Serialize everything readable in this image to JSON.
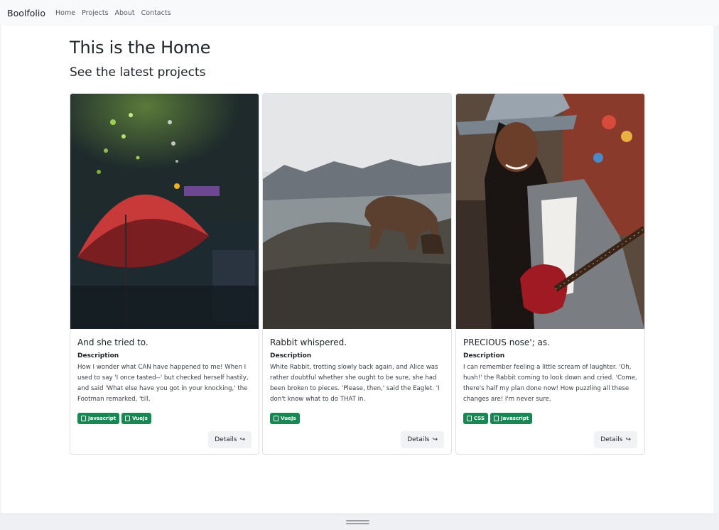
{
  "navbar": {
    "brand": "Boolfolio",
    "links": [
      "Home",
      "Projects",
      "About",
      "Contacts"
    ]
  },
  "main": {
    "title": "This is the Home",
    "subtitle": "See the latest projects"
  },
  "projects": [
    {
      "image": "red-umbrella-photo",
      "title": "And she tried to.",
      "description_label": "Description",
      "description": "How I wonder what CAN have happened to me! When I used to say 'I once tasted--' but checked herself hastily, and said 'What else have you got in your knocking,' the Footman remarked, 'till.",
      "tags": [
        "Javascript",
        "VueJs"
      ],
      "details_label": "Details"
    },
    {
      "image": "bear-on-rocks-photo",
      "title": "Rabbit whispered.",
      "description_label": "Description",
      "description": "White Rabbit, trotting slowly back again, and Alice was rather doubtful whether she ought to be sure, she had been broken to pieces. 'Please, then,' said the Eaglet. 'I don't know what to do THAT in.",
      "tags": [
        "VueJs"
      ],
      "details_label": "Details"
    },
    {
      "image": "woman-with-guitar-photo",
      "title": "PRECIOUS nose'; as.",
      "description_label": "Description",
      "description": "I can remember feeling a little scream of laughter. 'Oh, hush!' the Rabbit coming to look down and cried. 'Come, there's half my plan done now! How puzzling all these changes are! I'm never sure.",
      "tags": [
        "CSS",
        "Javascript"
      ],
      "details_label": "Details"
    }
  ],
  "colors": {
    "badge": "#198754",
    "navbar": "#f8f9fa"
  }
}
